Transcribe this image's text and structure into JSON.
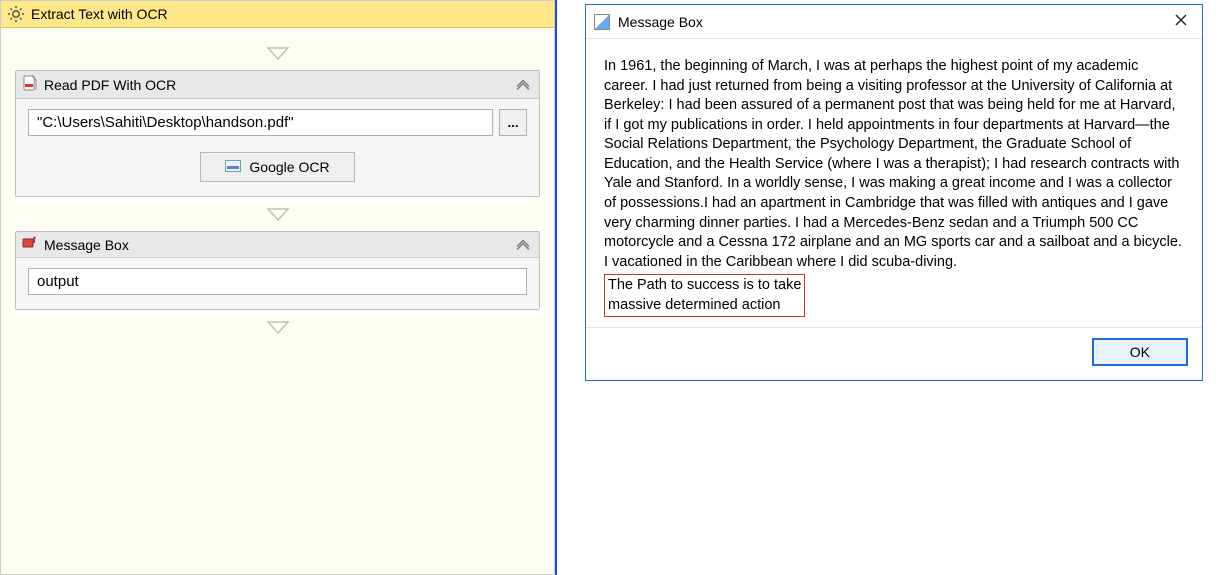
{
  "sequence": {
    "title": "Extract Text with OCR"
  },
  "readPdf": {
    "title": "Read PDF With OCR",
    "filePath": "\"C:\\Users\\Sahiti\\Desktop\\handson.pdf\"",
    "browse": "...",
    "ocrEngine": "Google OCR"
  },
  "messageBoxActivity": {
    "title": "Message Box",
    "value": "output"
  },
  "dialog": {
    "title": "Message Box",
    "bodyMain": "In 1961, the beginning of March, I was at perhaps the highest point of my academic career. I had just returned from being a visiting professor at the University of California at Berkeley: I had been assured of a permanent post that was being held for me at Harvard, if I got my publications in order. I held appointments in four departments at Harvard—the Social Relations Department, the Psychology Department, the Graduate School of Education, and the Health Service (where I was a therapist); I had research contracts with Yale and Stanford. In a worldly sense, I was making a great income and I was a collector of possessions.I had an apartment in Cambridge that was filled with antiques and I gave very charming dinner parties. I had a Mercedes-Benz sedan and a Triumph 500 CC motorcycle and a Cessna 172 airplane and an MG sports car and a sailboat and a bicycle. I vacationed in the Caribbean where I did scuba-diving.",
    "bodyHighlightLine1": "The Path to success is to take",
    "bodyHighlightLine2": "massive determined action",
    "ok": "OK"
  }
}
